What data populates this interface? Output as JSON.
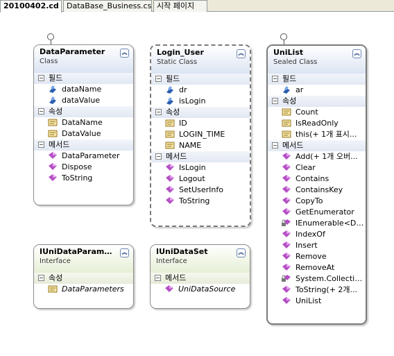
{
  "tabs": [
    {
      "label": "20100402.cd",
      "active": true
    },
    {
      "label": "DataBase_Business.cs",
      "active": false
    },
    {
      "label": "시작 페이지",
      "active": false
    }
  ],
  "collapse_glyph": "︽",
  "sections": {
    "fields": "필드",
    "properties": "속성",
    "methods": "메서드"
  },
  "classes": {
    "data_parameter": {
      "title": "DataParameter",
      "kind": "Class",
      "fields": [
        "dataName",
        "dataValue"
      ],
      "properties": [
        "DataName",
        "DataValue"
      ],
      "methods": [
        "DataParameter",
        "Dispose",
        "ToString"
      ]
    },
    "login_user": {
      "title": "Login_User",
      "kind": "Static Class",
      "fields": [
        "dr",
        "isLogin"
      ],
      "properties": [
        "ID",
        "LOGIN_TIME",
        "NAME"
      ],
      "methods": [
        "IsLogin",
        "Logout",
        "SetUserInfo",
        "ToString"
      ]
    },
    "uni_list": {
      "title": "UniList",
      "kind": "Sealed Class",
      "fields": [
        "ar"
      ],
      "properties": [
        "Count",
        "IsReadOnly",
        "this(+ 1개 표시..."
      ],
      "methods": [
        "Add(+ 1개 오버...",
        "Clear",
        "Contains",
        "ContainsKey",
        "CopyTo",
        "GetEnumerator",
        "IEnumerable<Da...",
        "IndexOf",
        "Insert",
        "Remove",
        "RemoveAt",
        "System.Collection...",
        "ToString(+ 2개...",
        "UniList"
      ]
    },
    "iuni_data_parameter": {
      "title": "IUniDataParame...",
      "kind": "Interface",
      "properties": [
        "DataParameters"
      ]
    },
    "iuni_data_set": {
      "title": "IUniDataSet",
      "kind": "Interface",
      "methods": [
        "UniDataSource"
      ]
    }
  },
  "icon_colors": {
    "field": "#2a5db0",
    "property": "#d6b24a",
    "method": "#b44fc4"
  }
}
